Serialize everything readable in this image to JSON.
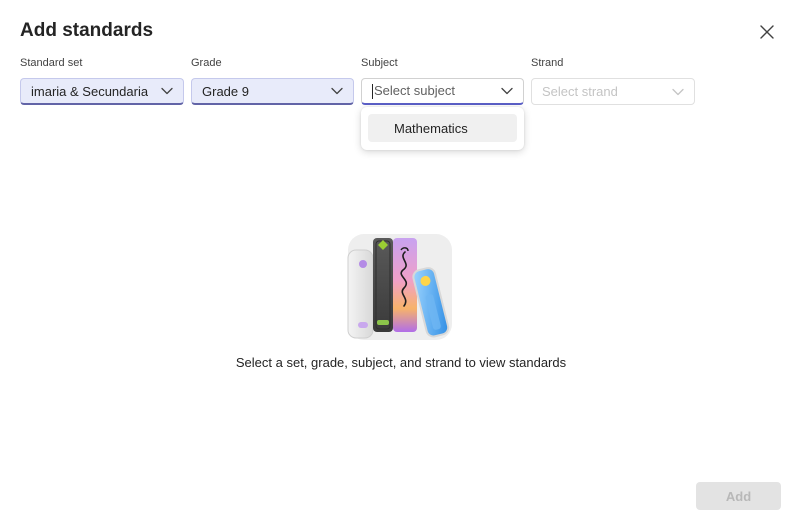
{
  "dialog": {
    "title": "Add standards",
    "close_icon": "close-icon"
  },
  "filters": {
    "standard_set": {
      "label": "Standard set",
      "value": "imaria & Secundaria"
    },
    "grade": {
      "label": "Grade",
      "value": "Grade 9"
    },
    "subject": {
      "label": "Subject",
      "placeholder": "Select subject",
      "expanded": true
    },
    "strand": {
      "label": "Strand",
      "placeholder": "Select strand",
      "disabled": true
    }
  },
  "subject_options": [
    "Mathematics"
  ],
  "empty_state": {
    "illustration": "books-illustration",
    "message": "Select a set, grade, subject, and strand to view standards"
  },
  "footer": {
    "add_label": "Add",
    "add_disabled": true
  },
  "colors": {
    "accent": "#5b5fc7",
    "filled_dropdown_bg": "#e8ebfa",
    "disabled_button_bg": "#e3e3e3"
  }
}
